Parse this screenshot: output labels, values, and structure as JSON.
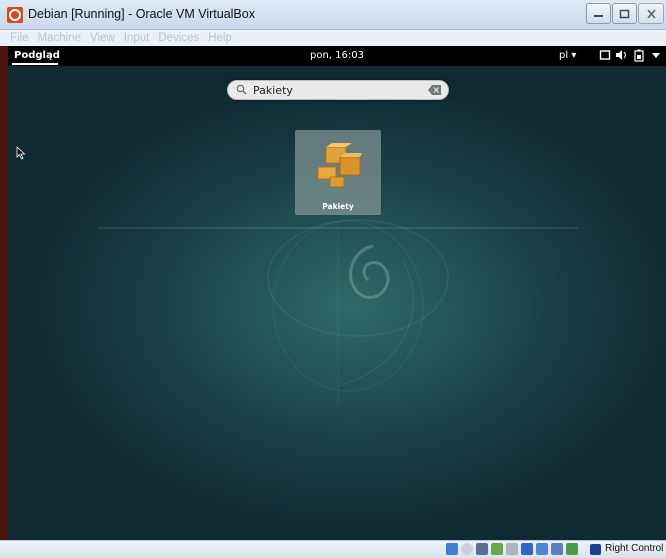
{
  "window": {
    "title": "Debian [Running] - Oracle VM VirtualBox",
    "icon": "virtualbox-icon"
  },
  "menubar": {
    "items": [
      "File",
      "Machine",
      "View",
      "Input",
      "Devices",
      "Help"
    ]
  },
  "gnome_topbar": {
    "activities": "Podgląd",
    "clock": "pon, 16:03",
    "language": "pl",
    "icons": [
      "screen-icon",
      "volume-icon",
      "battery-icon",
      "menu-arrow-icon"
    ]
  },
  "search": {
    "value": "Pakiety",
    "placeholder": ""
  },
  "results": [
    {
      "label": "Pakiety",
      "icon": "package-icon"
    }
  ],
  "statusbar": {
    "host_key": "Right Control",
    "icons": [
      "hdd-icon",
      "optical-icon",
      "usb-icon",
      "shared-folders-icon",
      "display-icon",
      "network-icon",
      "video-capture-icon",
      "cpu-icon",
      "mouse-integration-icon"
    ]
  },
  "colors": {
    "topbar": "#000000",
    "desktop": "#1f4a4c",
    "tile_highlight": "#8f9f9f"
  }
}
